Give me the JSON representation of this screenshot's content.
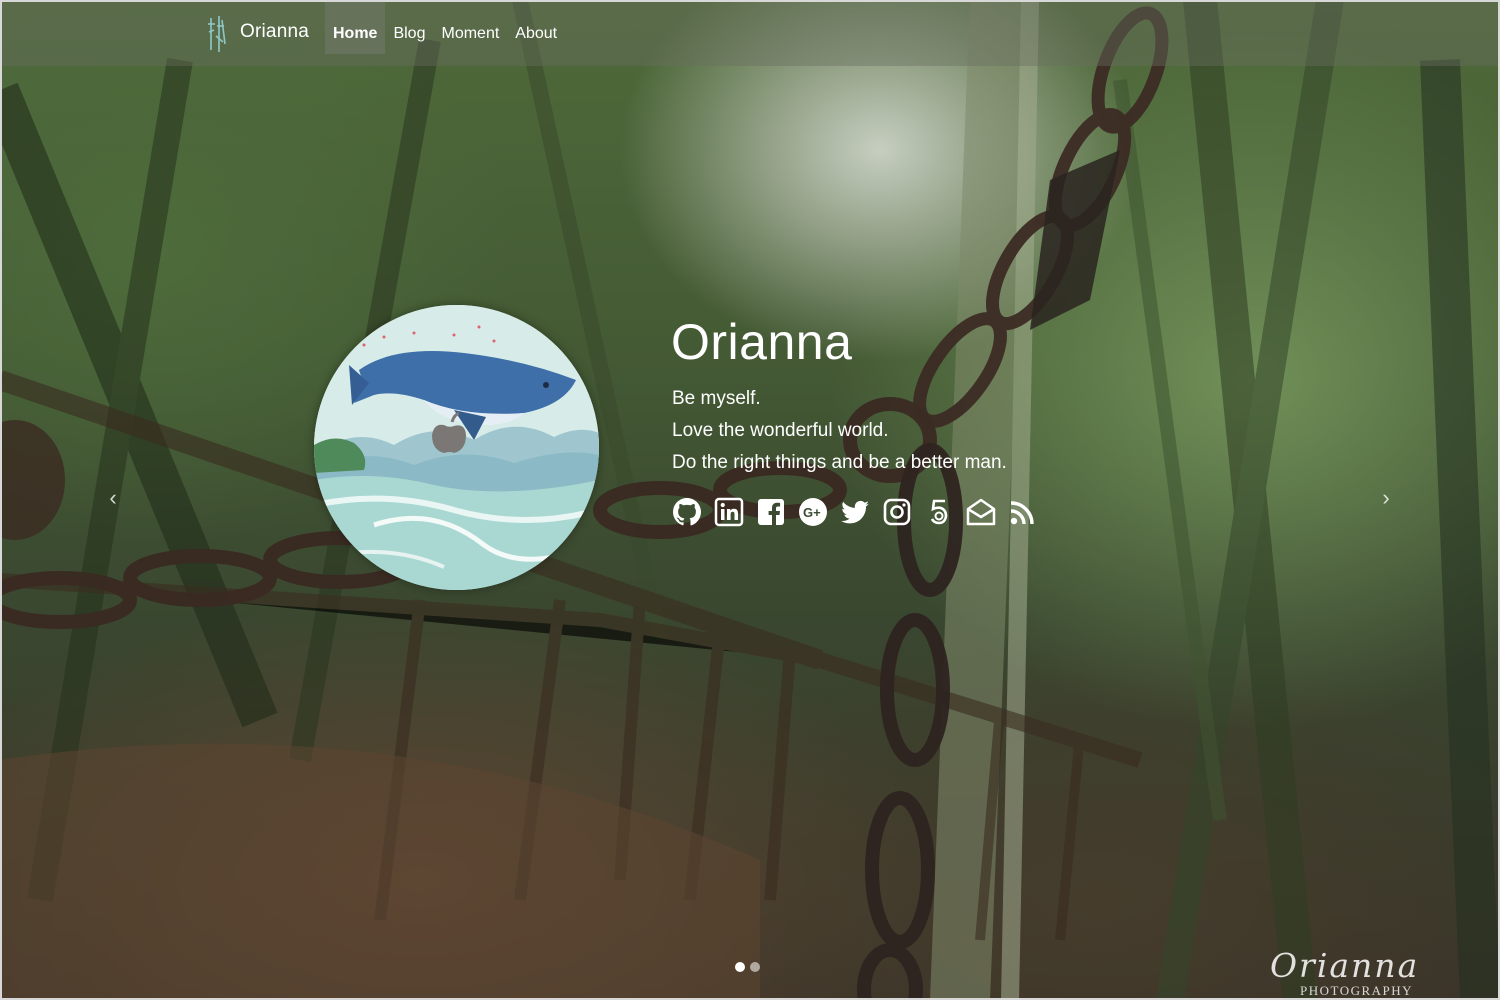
{
  "navbar": {
    "brand_name": "Orianna",
    "items": [
      {
        "label": "Home",
        "active": true
      },
      {
        "label": "Blog",
        "active": false
      },
      {
        "label": "Moment",
        "active": false
      },
      {
        "label": "About",
        "active": false
      }
    ]
  },
  "profile": {
    "name": "Orianna",
    "motto": [
      "Be myself.",
      "Love the wonderful world.",
      "Do the right things and be a better man."
    ]
  },
  "social_links": [
    {
      "icon": "github-icon"
    },
    {
      "icon": "linkedin-icon"
    },
    {
      "icon": "facebook-icon"
    },
    {
      "icon": "google-plus-icon"
    },
    {
      "icon": "twitter-icon"
    },
    {
      "icon": "instagram-icon"
    },
    {
      "icon": "500px-icon"
    },
    {
      "icon": "email-icon"
    },
    {
      "icon": "rss-icon"
    }
  ],
  "carousel": {
    "prev_symbol": "‹",
    "next_symbol": "›",
    "slide_count": 2,
    "active_slide": 1
  },
  "watermark": {
    "title": "Orianna",
    "subtitle": "PHOTOGRAPHY"
  },
  "colors": {
    "navbar_bg": "rgba(105,110,95,0.42)",
    "text": "#ffffff",
    "avatar_sea": "#bfe3dc"
  }
}
